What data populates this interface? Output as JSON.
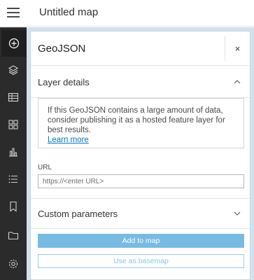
{
  "header": {
    "map_title": "Untitled map"
  },
  "rail": {
    "items": [
      {
        "icon": "add-icon",
        "active": true
      },
      {
        "icon": "layers-icon"
      },
      {
        "icon": "table-icon"
      },
      {
        "icon": "legend-icon"
      },
      {
        "icon": "charts-icon"
      },
      {
        "icon": "list-icon"
      },
      {
        "icon": "bookmark-icon"
      },
      {
        "icon": "folder-icon"
      },
      {
        "icon": "settings-icon"
      }
    ]
  },
  "panel": {
    "title": "GeoJSON",
    "close_label": "×",
    "layer_details": {
      "heading": "Layer details",
      "notice_text": "If this GeoJSON contains a large amount of data, consider publishing it as a hosted feature layer for best results.",
      "learn_more": "Learn more",
      "url_label": "URL",
      "url_placeholder": "https://<enter URL>",
      "url_value": ""
    },
    "custom_parameters": {
      "heading": "Custom parameters"
    },
    "add_to_map_label": "Add to map",
    "use_as_basemap_label": "Use as basemap"
  },
  "colors": {
    "rail_bg": "#2b2b2b",
    "primary_button": "#78bbe2",
    "link": "#0079c1",
    "map_bg": "#cfe2ef"
  }
}
